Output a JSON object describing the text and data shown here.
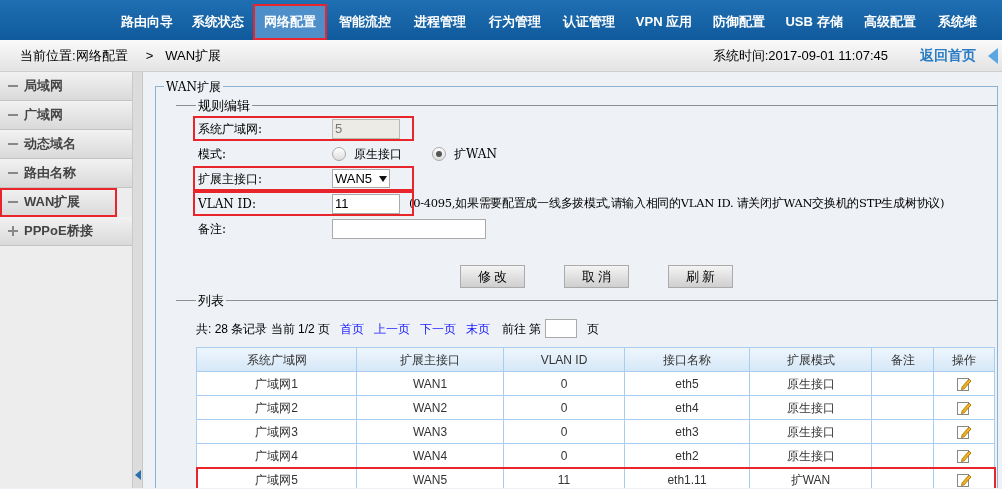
{
  "nav": [
    {
      "label": "路由向导",
      "selected": false,
      "highlighted": false
    },
    {
      "label": "系统状态",
      "selected": false,
      "highlighted": false
    },
    {
      "label": "网络配置",
      "selected": true,
      "highlighted": true
    },
    {
      "label": "智能流控",
      "selected": false,
      "highlighted": false
    },
    {
      "label": "进程管理",
      "selected": false,
      "highlighted": false
    },
    {
      "label": "行为管理",
      "selected": false,
      "highlighted": false
    },
    {
      "label": "认证管理",
      "selected": false,
      "highlighted": false
    },
    {
      "label": "VPN 应用",
      "selected": false,
      "highlighted": false
    },
    {
      "label": "防御配置",
      "selected": false,
      "highlighted": false
    },
    {
      "label": "USB 存储",
      "selected": false,
      "highlighted": false
    },
    {
      "label": "高级配置",
      "selected": false,
      "highlighted": false
    },
    {
      "label": "系统维",
      "selected": false,
      "highlighted": false
    }
  ],
  "breadcrumb": {
    "location": "当前位置:网络配置",
    "separator": ">",
    "current": "WAN扩展",
    "system_time": "系统时间:2017-09-01 11:07:45",
    "home_link": "返回首页"
  },
  "sidebar": {
    "items": [
      {
        "label": "局域网",
        "expanded": true,
        "highlighted": false
      },
      {
        "label": "广域网",
        "expanded": true,
        "highlighted": false
      },
      {
        "label": "动态域名",
        "expanded": true,
        "highlighted": false
      },
      {
        "label": "路由名称",
        "expanded": true,
        "highlighted": false
      },
      {
        "label": "WAN扩展",
        "expanded": true,
        "highlighted": true
      },
      {
        "label": "PPPoE桥接",
        "expanded": false,
        "highlighted": false
      }
    ]
  },
  "panel": {
    "title": "WAN扩展",
    "edit_section": "规则编辑",
    "fields": [
      {
        "kind": "text",
        "label": "系统广域网:",
        "value": "5",
        "disabled": true,
        "highlighted": true
      },
      {
        "kind": "radio",
        "label": "模式:",
        "options": [
          {
            "label": "原生接口",
            "selected": false
          },
          {
            "label": "扩WAN",
            "selected": true
          }
        ],
        "highlighted": false
      },
      {
        "kind": "select",
        "label": "扩展主接口:",
        "value": "WAN5",
        "highlighted": true
      },
      {
        "kind": "text",
        "label": "VLAN ID:",
        "value": "11",
        "disabled": false,
        "highlighted": true,
        "hint": "(0-4095,如果需要配置成一线多拨模式,请输入相同的VLAN ID. 请关闭扩WAN交换机的STP生成树协议)"
      },
      {
        "kind": "text",
        "label": "备注:",
        "disabled": false,
        "highlighted": false
      }
    ],
    "buttons": [
      "修 改",
      "取 消",
      "刷 新"
    ],
    "list_section": "列表",
    "pagination": {
      "summary": "共: 28 条记录 当前 1/2 页",
      "links": [
        "首页",
        "上一页",
        "下一页",
        "末页"
      ],
      "goto_prefix": "前往 第",
      "goto_suffix": "页"
    },
    "table": {
      "columns": [
        "系统广域网",
        "扩展主接口",
        "VLAN ID",
        "接口名称",
        "扩展模式",
        "备注",
        "操作"
      ],
      "rows": [
        {
          "cells": [
            "广域网1",
            "WAN1",
            "0",
            "eth5",
            "原生接口"
          ],
          "highlighted": false
        },
        {
          "cells": [
            "广域网2",
            "WAN2",
            "0",
            "eth4",
            "原生接口"
          ],
          "highlighted": false
        },
        {
          "cells": [
            "广域网3",
            "WAN3",
            "0",
            "eth3",
            "原生接口"
          ],
          "highlighted": false
        },
        {
          "cells": [
            "广域网4",
            "WAN4",
            "0",
            "eth2",
            "原生接口"
          ],
          "highlighted": false
        },
        {
          "cells": [
            "广域网5",
            "WAN5",
            "11",
            "eth1.11",
            "扩WAN"
          ],
          "highlighted": true
        }
      ]
    }
  }
}
